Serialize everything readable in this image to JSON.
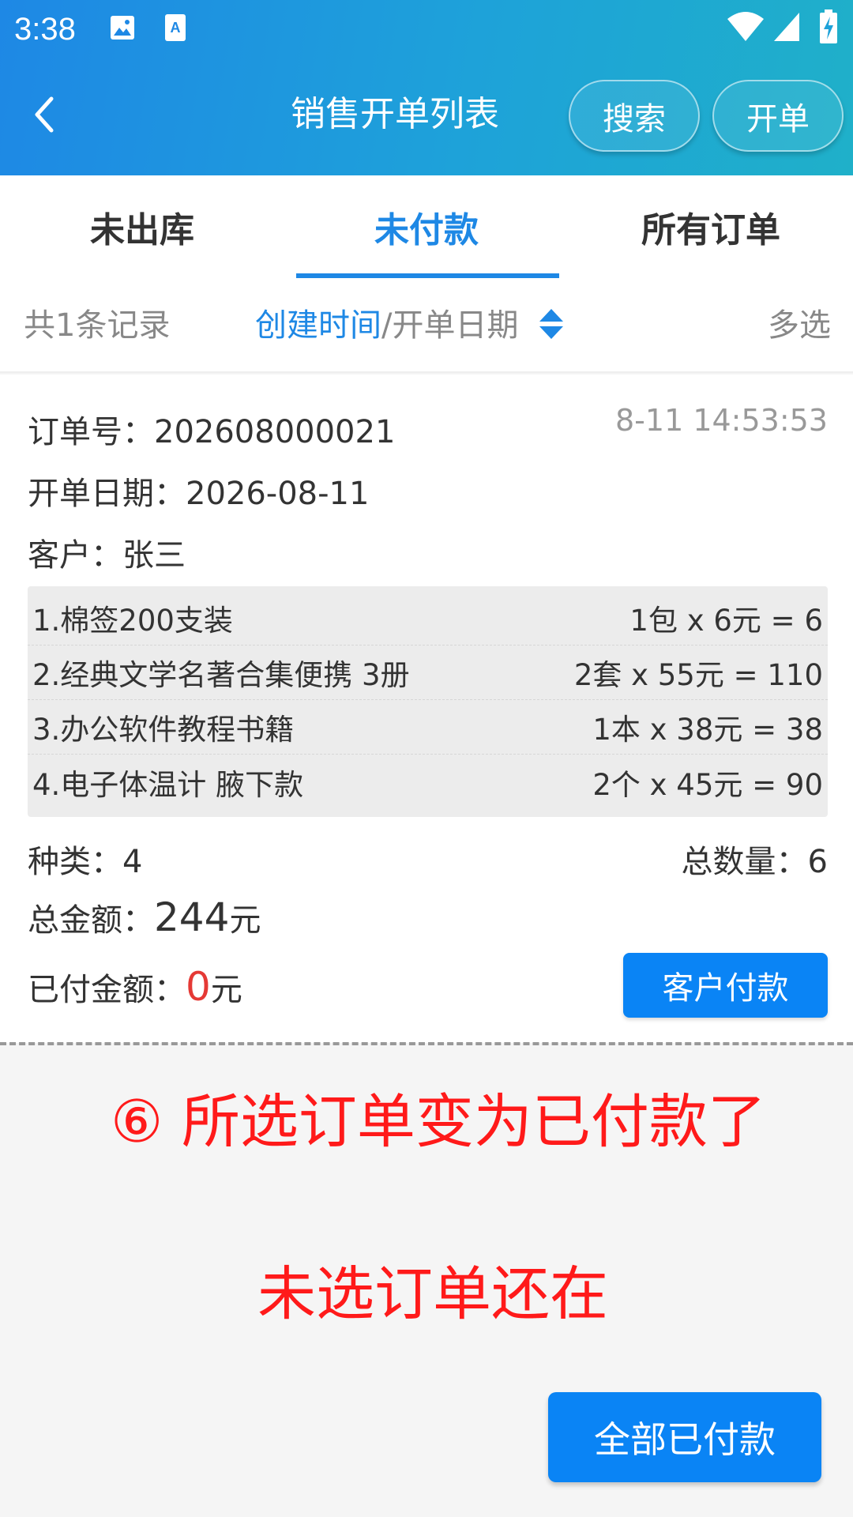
{
  "status_bar": {
    "time": "3:38"
  },
  "app_bar": {
    "title": "销售开单列表",
    "search_label": "搜索",
    "new_order_label": "开单"
  },
  "tabs": [
    {
      "label": "未出库",
      "active": false
    },
    {
      "label": "未付款",
      "active": true
    },
    {
      "label": "所有订单",
      "active": false
    }
  ],
  "filter_bar": {
    "record_count": "共1条记录",
    "sort_created": "创建时间",
    "sort_separator": "/",
    "sort_order_date": "开单日期",
    "multi_select": "多选"
  },
  "order": {
    "order_no": "订单号：202608000021",
    "timestamp": "8-11 14:53:53",
    "order_date": "开单日期：2026-08-11",
    "customer": "客户：张三",
    "items": [
      {
        "name": "1.棉签200支装",
        "calc": "1包 x 6元 = 6"
      },
      {
        "name": "2.经典文学名著合集便携 3册",
        "calc": "2套 x 55元 = 110"
      },
      {
        "name": "3.办公软件教程书籍",
        "calc": "1本 x 38元 = 38"
      },
      {
        "name": "4.电子体温计 腋下款",
        "calc": "2个 x 45元 = 90"
      }
    ],
    "kinds": "种类：4",
    "total_qty": "总数量：6",
    "total_amount_label": "总金额：",
    "total_amount_value": "244",
    "total_amount_unit": "元",
    "paid_label": "已付金额：",
    "paid_value": "0",
    "paid_unit": "元",
    "pay_button": "客户付款"
  },
  "annotations": {
    "line1": "⑥ 所选订单变为已付款了",
    "line2": "未选订单还在"
  },
  "bottom_button": "全部已付款",
  "colors": {
    "accent": "#1e88e5",
    "button": "#0a84f5",
    "annotation": "#ff1a1a",
    "paid_zero": "#e53935"
  }
}
